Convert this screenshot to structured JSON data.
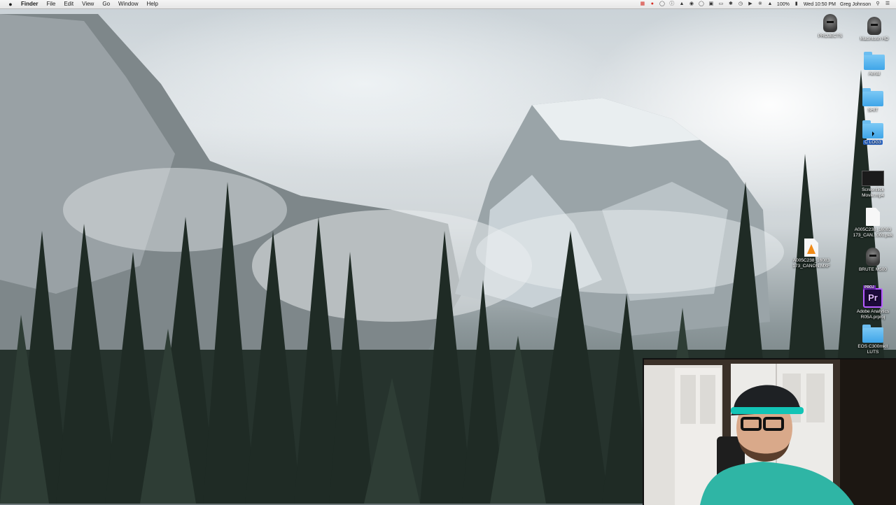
{
  "menubar": {
    "app_name": "Finder",
    "menus": [
      "File",
      "Edit",
      "View",
      "Go",
      "Window",
      "Help"
    ],
    "battery": "100%",
    "clock": "Wed 10:50 PM",
    "user": "Greg Johnson"
  },
  "desktop_icons": {
    "projects": "PROJECTS",
    "macintosh_hd": "Macintosh HD",
    "aerial": "Aerial",
    "shit": "SHIT",
    "c_log3": "C LOG3",
    "screenflick": "Screenflick Movie.mp4",
    "a005_pek": "A005C238_16083 173_CAN...000.pek",
    "a005_mxf": "A005C238_16083 173_CANON.MXF",
    "brute": "BRUTE M500",
    "adobe_proj": "Adobe Analytics R05A.prproj",
    "adobe_badge": "PROJ",
    "adobe_glyph": "Pr",
    "eos": "EOS C300mkII LUTS"
  },
  "colors": {
    "menubar_bg": "#eeeeee",
    "folder_blue": "#4aaef0",
    "selection_blue": "#2f6fd6",
    "premiere_purple": "#b65cff"
  }
}
